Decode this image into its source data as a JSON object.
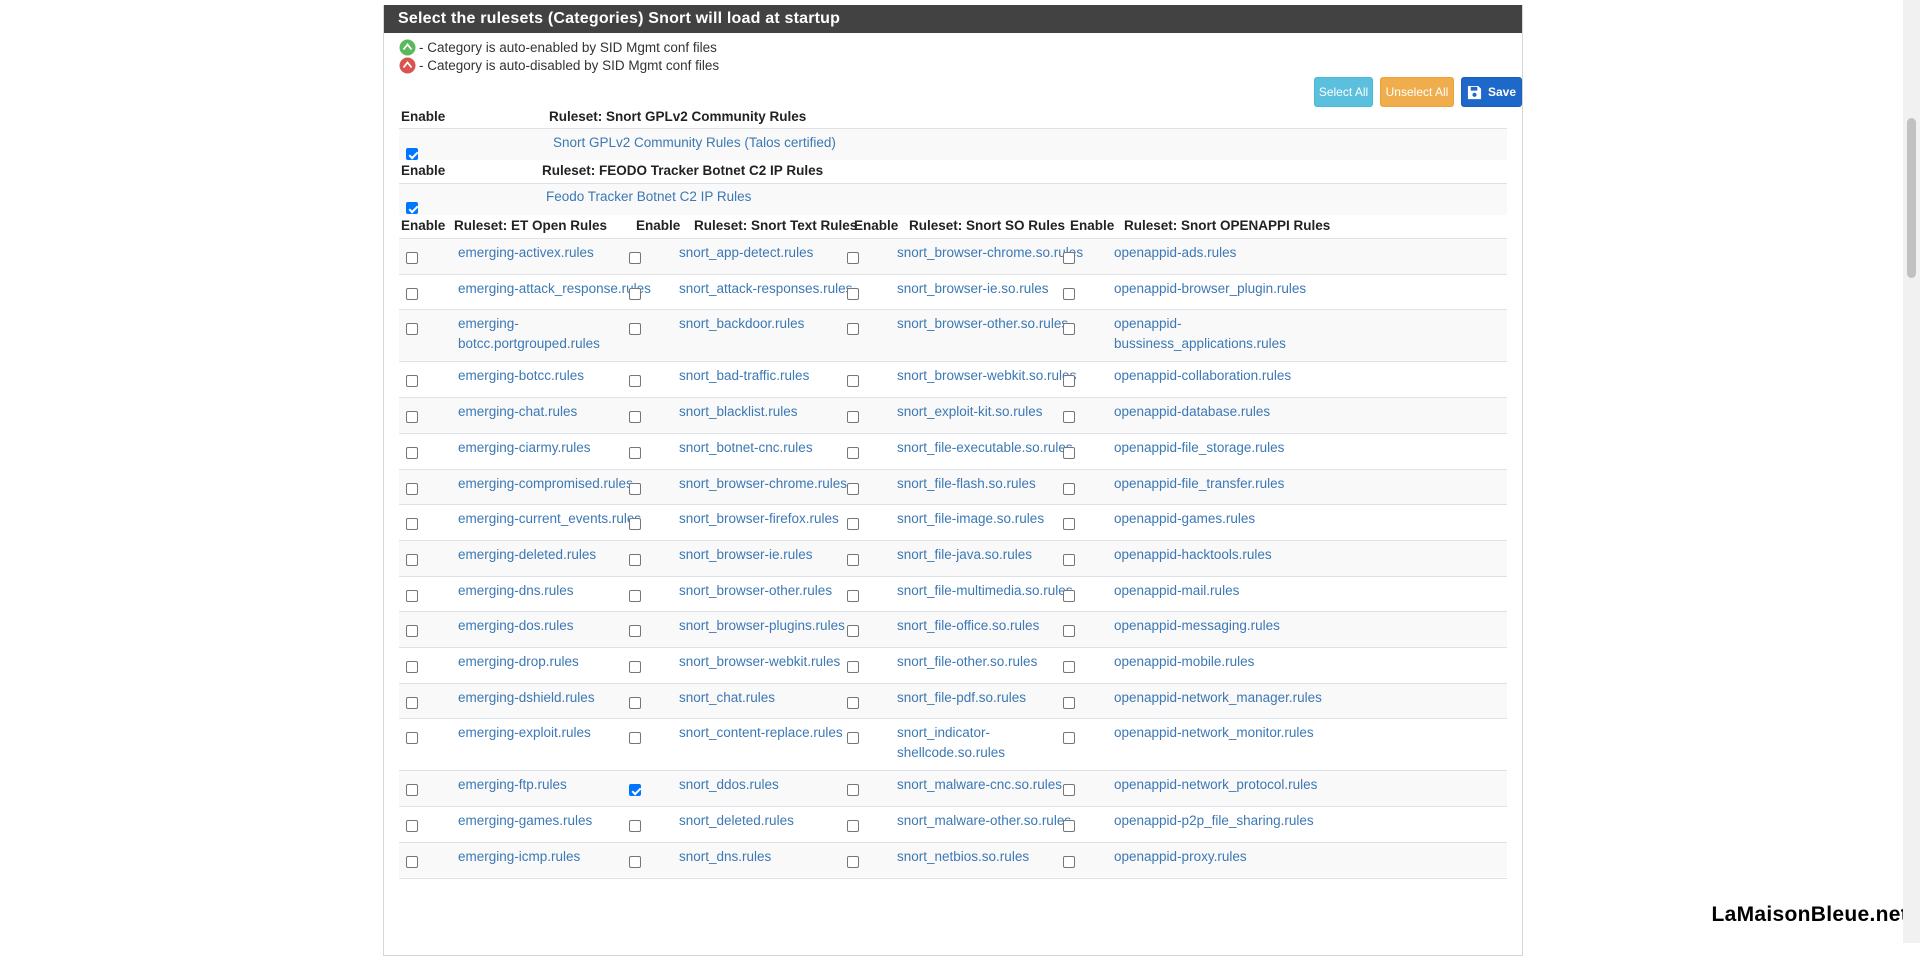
{
  "panel": {
    "title": "Select the rulesets (Categories) Snort will load at startup",
    "legend_enabled": "- Category is auto-enabled by SID Mgmt conf files",
    "legend_disabled": "- Category is auto-disabled by SID Mgmt conf files",
    "buttons": {
      "select_all": "Select All",
      "unselect_all": "Unselect All",
      "save": "Save"
    }
  },
  "headers": {
    "enable": "Enable"
  },
  "gplv2": {
    "header": "Ruleset: Snort GPLv2 Community Rules",
    "rule": "Snort GPLv2 Community Rules (Talos certified)",
    "checked": true
  },
  "feodo": {
    "header": "Ruleset: FEODO Tracker Botnet C2 IP Rules",
    "rule": "Feodo Tracker Botnet C2 IP Rules",
    "checked": true
  },
  "columns": [
    {
      "header": "Ruleset: ET Open Rules"
    },
    {
      "header": "Ruleset: Snort Text Rules"
    },
    {
      "header": "Ruleset: Snort SO Rules"
    },
    {
      "header": "Ruleset: Snort OPENAPPI Rules"
    }
  ],
  "rows": [
    [
      {
        "name": "emerging-activex.rules",
        "checked": false
      },
      {
        "name": "snort_app-detect.rules",
        "checked": false
      },
      {
        "name": "snort_browser-chrome.so.rules",
        "checked": false
      },
      {
        "name": "openappid-ads.rules",
        "checked": false
      }
    ],
    [
      {
        "name": "emerging-attack_response.rules",
        "checked": false
      },
      {
        "name": "snort_attack-responses.rules",
        "checked": false
      },
      {
        "name": "snort_browser-ie.so.rules",
        "checked": false
      },
      {
        "name": "openappid-browser_plugin.rules",
        "checked": false
      }
    ],
    [
      {
        "name": "emerging-botcc.portgrouped.rules",
        "line1": "emerging-",
        "line2": "botcc.portgrouped.rules",
        "checked": false
      },
      {
        "name": "snort_backdoor.rules",
        "checked": false
      },
      {
        "name": "snort_browser-other.so.rules",
        "checked": false
      },
      {
        "name": "openappid-bussiness_applications.rules",
        "line1": "openappid-",
        "line2": "bussiness_applications.rules",
        "checked": false
      }
    ],
    [
      {
        "name": "emerging-botcc.rules",
        "checked": false
      },
      {
        "name": "snort_bad-traffic.rules",
        "checked": false
      },
      {
        "name": "snort_browser-webkit.so.rules",
        "checked": false
      },
      {
        "name": "openappid-collaboration.rules",
        "checked": false
      }
    ],
    [
      {
        "name": "emerging-chat.rules",
        "checked": false
      },
      {
        "name": "snort_blacklist.rules",
        "checked": false
      },
      {
        "name": "snort_exploit-kit.so.rules",
        "checked": false
      },
      {
        "name": "openappid-database.rules",
        "checked": false
      }
    ],
    [
      {
        "name": "emerging-ciarmy.rules",
        "checked": false
      },
      {
        "name": "snort_botnet-cnc.rules",
        "checked": false
      },
      {
        "name": "snort_file-executable.so.rules",
        "checked": false
      },
      {
        "name": "openappid-file_storage.rules",
        "checked": false
      }
    ],
    [
      {
        "name": "emerging-compromised.rules",
        "checked": false
      },
      {
        "name": "snort_browser-chrome.rules",
        "checked": false
      },
      {
        "name": "snort_file-flash.so.rules",
        "checked": false
      },
      {
        "name": "openappid-file_transfer.rules",
        "checked": false
      }
    ],
    [
      {
        "name": "emerging-current_events.rules",
        "checked": false
      },
      {
        "name": "snort_browser-firefox.rules",
        "checked": false
      },
      {
        "name": "snort_file-image.so.rules",
        "checked": false
      },
      {
        "name": "openappid-games.rules",
        "checked": false
      }
    ],
    [
      {
        "name": "emerging-deleted.rules",
        "checked": false
      },
      {
        "name": "snort_browser-ie.rules",
        "checked": false
      },
      {
        "name": "snort_file-java.so.rules",
        "checked": false
      },
      {
        "name": "openappid-hacktools.rules",
        "checked": false
      }
    ],
    [
      {
        "name": "emerging-dns.rules",
        "checked": false
      },
      {
        "name": "snort_browser-other.rules",
        "checked": false
      },
      {
        "name": "snort_file-multimedia.so.rules",
        "checked": false
      },
      {
        "name": "openappid-mail.rules",
        "checked": false
      }
    ],
    [
      {
        "name": "emerging-dos.rules",
        "checked": false
      },
      {
        "name": "snort_browser-plugins.rules",
        "checked": false
      },
      {
        "name": "snort_file-office.so.rules",
        "checked": false
      },
      {
        "name": "openappid-messaging.rules",
        "checked": false
      }
    ],
    [
      {
        "name": "emerging-drop.rules",
        "checked": false
      },
      {
        "name": "snort_browser-webkit.rules",
        "checked": false
      },
      {
        "name": "snort_file-other.so.rules",
        "checked": false
      },
      {
        "name": "openappid-mobile.rules",
        "checked": false
      }
    ],
    [
      {
        "name": "emerging-dshield.rules",
        "checked": false
      },
      {
        "name": "snort_chat.rules",
        "checked": false
      },
      {
        "name": "snort_file-pdf.so.rules",
        "checked": false
      },
      {
        "name": "openappid-network_manager.rules",
        "checked": false
      }
    ],
    [
      {
        "name": "emerging-exploit.rules",
        "checked": false
      },
      {
        "name": "snort_content-replace.rules",
        "checked": false
      },
      {
        "name": "snort_indicator-shellcode.so.rules",
        "line1": "snort_indicator-",
        "line2": "shellcode.so.rules",
        "checked": false
      },
      {
        "name": "openappid-network_monitor.rules",
        "checked": false
      }
    ],
    [
      {
        "name": "emerging-ftp.rules",
        "checked": false
      },
      {
        "name": "snort_ddos.rules",
        "checked": true
      },
      {
        "name": "snort_malware-cnc.so.rules",
        "checked": false
      },
      {
        "name": "openappid-network_protocol.rules",
        "checked": false
      }
    ],
    [
      {
        "name": "emerging-games.rules",
        "checked": false
      },
      {
        "name": "snort_deleted.rules",
        "checked": false
      },
      {
        "name": "snort_malware-other.so.rules",
        "checked": false
      },
      {
        "name": "openappid-p2p_file_sharing.rules",
        "checked": false
      }
    ],
    [
      {
        "name": "emerging-icmp.rules",
        "checked": false
      },
      {
        "name": "snort_dns.rules",
        "checked": false
      },
      {
        "name": "snort_netbios.so.rules",
        "checked": false
      },
      {
        "name": "openappid-proxy.rules",
        "checked": false
      }
    ]
  ],
  "watermark": "LaMaisonBleue.net",
  "colors": {
    "heading_bg": "#424242",
    "link": "#3c78b4",
    "info": "#5bc0de",
    "warning": "#f0ad4e",
    "primary": "#1d68c8",
    "auto_enabled": "#5cb85c",
    "auto_disabled": "#d9534f"
  }
}
